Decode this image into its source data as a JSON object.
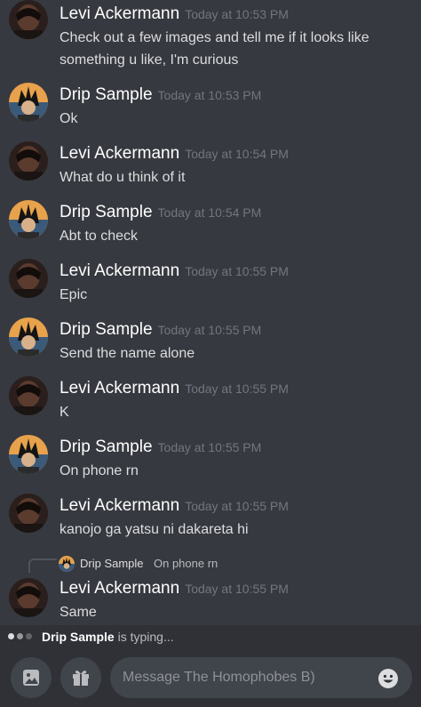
{
  "messages": [
    {
      "author": "Levi Ackermann",
      "timestamp": "Today at 10:53 PM",
      "lines": [
        "Check out a few images and tell me if it looks like",
        "something u like, I'm curious"
      ],
      "avatar_icon": "levi-avatar-icon"
    },
    {
      "author": "Drip Sample",
      "timestamp": "Today at 10:53 PM",
      "lines": [
        "Ok"
      ],
      "avatar_icon": "drip-avatar-icon"
    },
    {
      "author": "Levi Ackermann",
      "timestamp": "Today at 10:54 PM",
      "lines": [
        "What do u think of it"
      ],
      "avatar_icon": "levi-avatar-icon"
    },
    {
      "author": "Drip Sample",
      "timestamp": "Today at 10:54 PM",
      "lines": [
        "Abt to check"
      ],
      "avatar_icon": "drip-avatar-icon"
    },
    {
      "author": "Levi Ackermann",
      "timestamp": "Today at 10:55 PM",
      "lines": [
        "Epic"
      ],
      "avatar_icon": "levi-avatar-icon"
    },
    {
      "author": "Drip Sample",
      "timestamp": "Today at 10:55 PM",
      "lines": [
        "Send the name alone"
      ],
      "avatar_icon": "drip-avatar-icon"
    },
    {
      "author": "Levi Ackermann",
      "timestamp": "Today at 10:55 PM",
      "lines": [
        "K"
      ],
      "avatar_icon": "levi-avatar-icon"
    },
    {
      "author": "Drip Sample",
      "timestamp": "Today at 10:55 PM",
      "lines": [
        "On phone rn"
      ],
      "avatar_icon": "drip-avatar-icon"
    },
    {
      "author": "Levi Ackermann",
      "timestamp": "Today at 10:55 PM",
      "lines": [
        "kanojo ga yatsu ni dakareta hi"
      ],
      "avatar_icon": "levi-avatar-icon"
    },
    {
      "author": "Levi Ackermann",
      "timestamp": "Today at 10:55 PM",
      "lines": [
        "Same"
      ],
      "avatar_icon": "levi-avatar-icon"
    }
  ],
  "reply": {
    "author": "Drip Sample",
    "text": "On phone rn",
    "avatar_icon": "drip-avatar-icon"
  },
  "typing": {
    "user": "Drip Sample",
    "suffix": " is typing..."
  },
  "composer": {
    "placeholder": "Message The Homophobes B)",
    "image_icon": "image-icon",
    "gift_icon": "gift-icon",
    "emoji_icon": "emoji-icon"
  },
  "colors": {
    "background": "#36393f",
    "panel": "#2f3136",
    "input": "#40444b",
    "username": "#ffffff",
    "timestamp": "#72767d",
    "text": "#dcddde"
  }
}
